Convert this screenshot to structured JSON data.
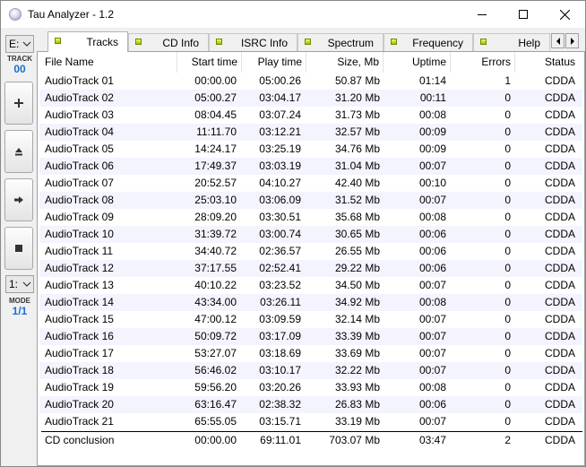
{
  "window": {
    "title": "Tau Analyzer - 1.2"
  },
  "leftbar": {
    "drive_value": "E:",
    "track_label": "TRACK",
    "track_number": "00",
    "mode_value": "1:",
    "mode_label": "MODE",
    "mode_display": "1/1"
  },
  "tabs": [
    {
      "label": "Tracks",
      "active": true
    },
    {
      "label": "CD Info",
      "active": false
    },
    {
      "label": "ISRC Info",
      "active": false
    },
    {
      "label": "Spectrum",
      "active": false
    },
    {
      "label": "Frequency",
      "active": false
    },
    {
      "label": "Help",
      "active": false
    }
  ],
  "table": {
    "headers": [
      "File Name",
      "Start time",
      "Play time",
      "Size, Mb",
      "Uptime",
      "Errors",
      "Status"
    ],
    "rows": [
      [
        "AudioTrack 01",
        "00:00.00",
        "05:00.26",
        "50.87 Mb",
        "01:14",
        "1",
        "CDDA"
      ],
      [
        "AudioTrack 02",
        "05:00.27",
        "03:04.17",
        "31.20 Mb",
        "00:11",
        "0",
        "CDDA"
      ],
      [
        "AudioTrack 03",
        "08:04.45",
        "03:07.24",
        "31.73 Mb",
        "00:08",
        "0",
        "CDDA"
      ],
      [
        "AudioTrack 04",
        "11:11.70",
        "03:12.21",
        "32.57 Mb",
        "00:09",
        "0",
        "CDDA"
      ],
      [
        "AudioTrack 05",
        "14:24.17",
        "03:25.19",
        "34.76 Mb",
        "00:09",
        "0",
        "CDDA"
      ],
      [
        "AudioTrack 06",
        "17:49.37",
        "03:03.19",
        "31.04 Mb",
        "00:07",
        "0",
        "CDDA"
      ],
      [
        "AudioTrack 07",
        "20:52.57",
        "04:10.27",
        "42.40 Mb",
        "00:10",
        "0",
        "CDDA"
      ],
      [
        "AudioTrack 08",
        "25:03.10",
        "03:06.09",
        "31.52 Mb",
        "00:07",
        "0",
        "CDDA"
      ],
      [
        "AudioTrack 09",
        "28:09.20",
        "03:30.51",
        "35.68 Mb",
        "00:08",
        "0",
        "CDDA"
      ],
      [
        "AudioTrack 10",
        "31:39.72",
        "03:00.74",
        "30.65 Mb",
        "00:06",
        "0",
        "CDDA"
      ],
      [
        "AudioTrack 11",
        "34:40.72",
        "02:36.57",
        "26.55 Mb",
        "00:06",
        "0",
        "CDDA"
      ],
      [
        "AudioTrack 12",
        "37:17.55",
        "02:52.41",
        "29.22 Mb",
        "00:06",
        "0",
        "CDDA"
      ],
      [
        "AudioTrack 13",
        "40:10.22",
        "03:23.52",
        "34.50 Mb",
        "00:07",
        "0",
        "CDDA"
      ],
      [
        "AudioTrack 14",
        "43:34.00",
        "03:26.11",
        "34.92 Mb",
        "00:08",
        "0",
        "CDDA"
      ],
      [
        "AudioTrack 15",
        "47:00.12",
        "03:09.59",
        "32.14 Mb",
        "00:07",
        "0",
        "CDDA"
      ],
      [
        "AudioTrack 16",
        "50:09.72",
        "03:17.09",
        "33.39 Mb",
        "00:07",
        "0",
        "CDDA"
      ],
      [
        "AudioTrack 17",
        "53:27.07",
        "03:18.69",
        "33.69 Mb",
        "00:07",
        "0",
        "CDDA"
      ],
      [
        "AudioTrack 18",
        "56:46.02",
        "03:10.17",
        "32.22 Mb",
        "00:07",
        "0",
        "CDDA"
      ],
      [
        "AudioTrack 19",
        "59:56.20",
        "03:20.26",
        "33.93 Mb",
        "00:08",
        "0",
        "CDDA"
      ],
      [
        "AudioTrack 20",
        "63:16.47",
        "02:38.32",
        "26.83 Mb",
        "00:06",
        "0",
        "CDDA"
      ],
      [
        "AudioTrack 21",
        "65:55.05",
        "03:15.71",
        "33.19 Mb",
        "00:07",
        "0",
        "CDDA"
      ]
    ],
    "summary": [
      "CD conclusion",
      "00:00.00",
      "69:11.01",
      "703.07 Mb",
      "03:47",
      "2",
      "CDDA"
    ]
  },
  "colors": {
    "accent_blue": "#1a6fd0",
    "row_alt": "#f4f4ff",
    "led_green": "#9ac400"
  },
  "icons": [
    "app-icon",
    "minimize-icon",
    "maximize-icon",
    "close-icon",
    "chevron-down-icon",
    "plus-icon",
    "eject-icon",
    "arrow-right-icon",
    "stop-icon",
    "scroll-left-icon",
    "scroll-right-icon"
  ]
}
